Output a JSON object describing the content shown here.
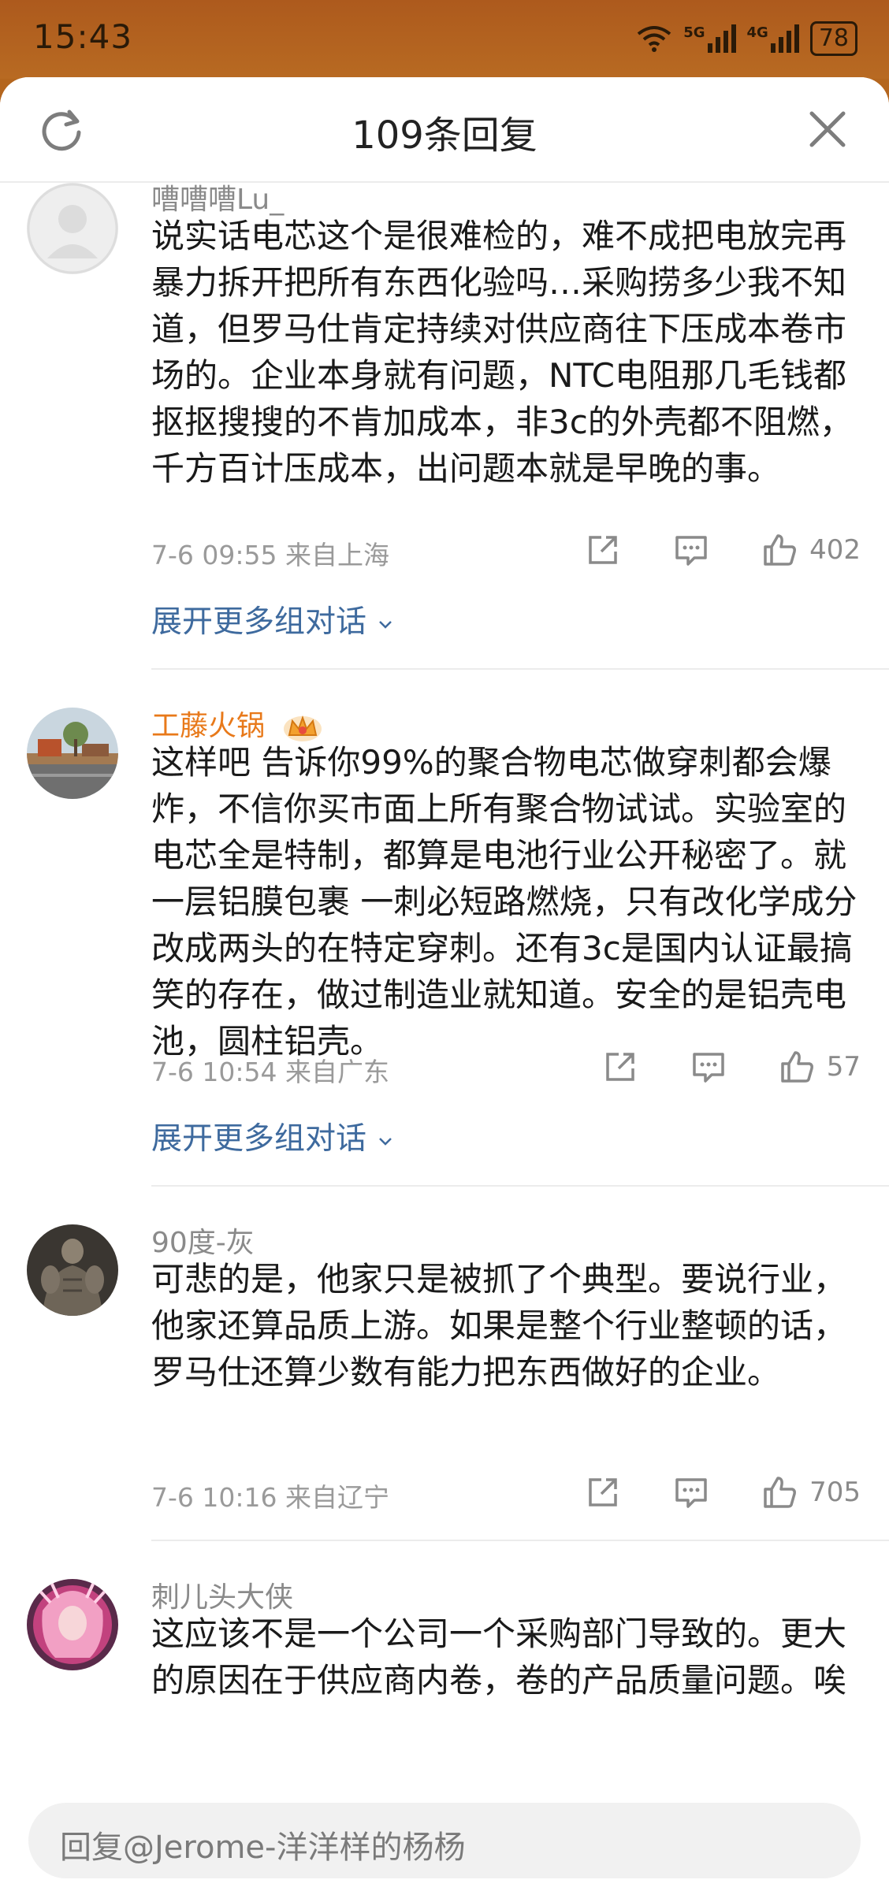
{
  "status_bar": {
    "time": "15:43",
    "network_1": "5G",
    "network_2": "4G",
    "battery": "78"
  },
  "header": {
    "title": "109条回复",
    "refresh_icon": "refresh-icon",
    "close_icon": "close-icon"
  },
  "comments": [
    {
      "username": "嘈嘈嘈Lu_",
      "text": "说实话电芯这个是很难检的，难不成把电放完再暴力拆开把所有东西化验吗…采购捞多少我不知道，但罗马仕肯定持续对供应商往下压成本卷市场的。企业本身就有问题，NTC电阻那几毛钱都抠抠搜搜的不肯加成本，非3c的外壳都不阻燃，千方百计压成本，出问题本就是早晚的事。",
      "meta": "7-6 09:55  来自上海",
      "likes": "402",
      "expand": "展开更多组对话"
    },
    {
      "username": "工藤火锅",
      "text": "这样吧 告诉你99%的聚合物电芯做穿刺都会爆炸，不信你买市面上所有聚合物试试。实验室的电芯全是特制，都算是电池行业公开秘密了。就一层铝膜包裹 一刺必短路燃烧，只有改化学成分改成两头的在特定穿刺。还有3c是国内认证最搞笑的存在，做过制造业就知道。安全的是铝壳电池，圆柱铝壳。",
      "meta": "7-6 10:54  来自广东",
      "likes": "57",
      "expand": "展开更多组对话"
    },
    {
      "username": "90度-灰",
      "text": "可悲的是，他家只是被抓了个典型。要说行业，他家还算品质上游。如果是整个行业整顿的话，罗马仕还算少数有能力把东西做好的企业。",
      "meta": "7-6 10:16  来自辽宁",
      "likes": "705"
    },
    {
      "username": "刺儿头大侠",
      "text": "这应该不是一个公司一个采购部门导致的。更大的原因在于供应商内卷，卷的产品质量问题。唉"
    }
  ],
  "reply_box": {
    "placeholder": "回复@Jerome-洋洋样的杨杨"
  },
  "colors": {
    "link": "#3e6a9e",
    "vip_name": "#e8791a",
    "status_bg": "#b4661e"
  }
}
